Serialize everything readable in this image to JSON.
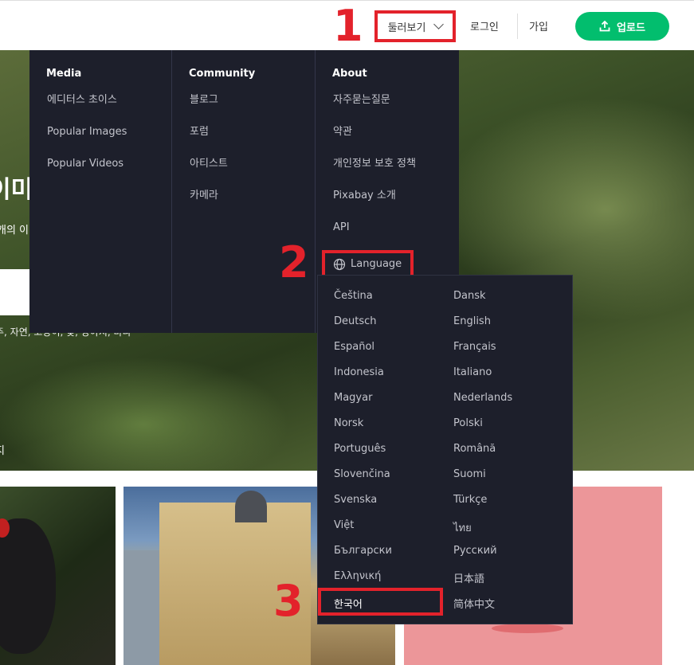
{
  "header": {
    "browse_label": "둘러보기",
    "login_label": "로그인",
    "join_label": "가입",
    "upload_label": "업로드"
  },
  "annotations": [
    "1",
    "2",
    "3"
  ],
  "hero": {
    "title": "이미",
    "subtitle": "개의 이",
    "tags": "주, 자연, 고양이, 꽃, 강아지, 바다",
    "credit": "지"
  },
  "menu": {
    "columns": [
      {
        "heading": "Media",
        "items": [
          "에디터스 초이스",
          "Popular Images",
          "Popular Videos"
        ]
      },
      {
        "heading": "Community",
        "items": [
          "블로그",
          "포럼",
          "아티스트",
          "카메라"
        ]
      },
      {
        "heading": "About",
        "items": [
          "자주묻는질문",
          "약관",
          "개인정보 보호 정책",
          "Pixabay 소개",
          "API"
        ]
      }
    ],
    "language_label": "Language"
  },
  "languages": [
    [
      "Čeština",
      "Dansk"
    ],
    [
      "Deutsch",
      "English"
    ],
    [
      "Español",
      "Français"
    ],
    [
      "Indonesia",
      "Italiano"
    ],
    [
      "Magyar",
      "Nederlands"
    ],
    [
      "Norsk",
      "Polski"
    ],
    [
      "Português",
      "Română"
    ],
    [
      "Slovenčina",
      "Suomi"
    ],
    [
      "Svenska",
      "Türkçe"
    ],
    [
      "Việt",
      "ไทย"
    ],
    [
      "Български",
      "Русский"
    ],
    [
      "Ελληνική",
      "日本語"
    ],
    [
      "한국어",
      "简体中文"
    ]
  ],
  "colors": {
    "accent_red": "#e3222b",
    "upload_green": "#02be6e",
    "menu_bg": "#1d1f2b"
  },
  "icons": [
    "chevron-down-icon",
    "upload-icon",
    "globe-icon"
  ]
}
